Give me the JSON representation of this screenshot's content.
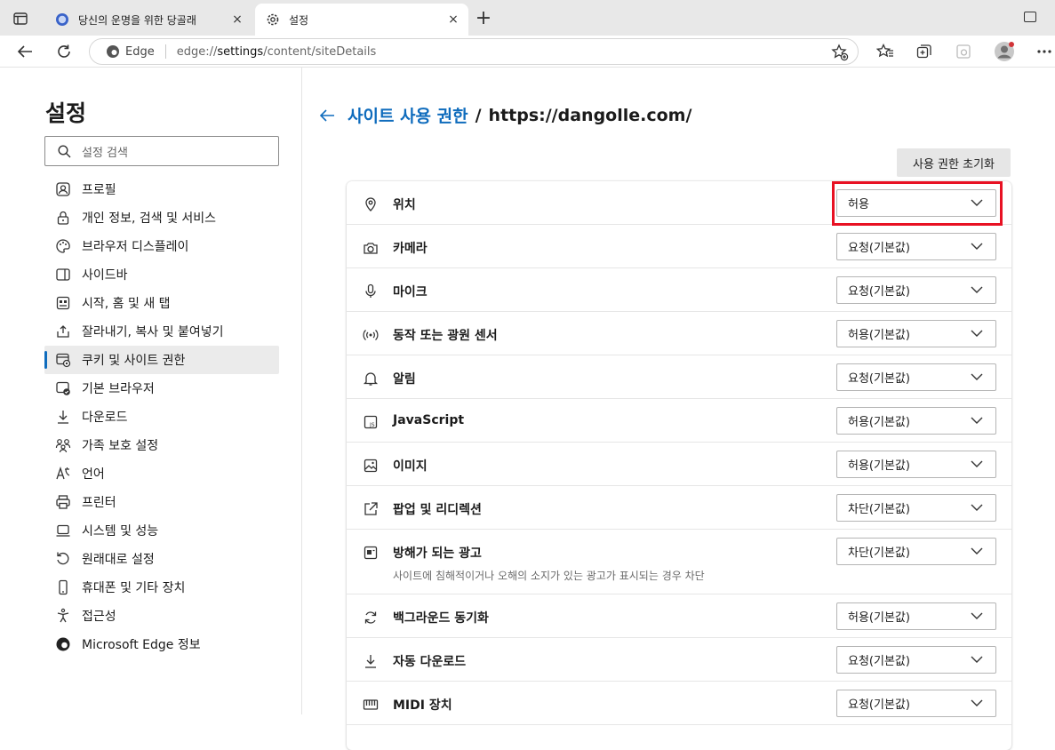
{
  "tabs": [
    {
      "title": "당신의 운명을 위한 당골래",
      "close": "×"
    },
    {
      "title": "설정",
      "close": "×"
    }
  ],
  "new_tab": "+",
  "address_bar": {
    "browser_label": "Edge",
    "url_scheme": "edge://",
    "url_host": "settings",
    "url_path": "/content/siteDetails"
  },
  "sidebar": {
    "title": "설정",
    "search_placeholder": "설정 검색",
    "items": [
      {
        "label": "프로필",
        "icon": "profile-icon"
      },
      {
        "label": "개인 정보, 검색 및 서비스",
        "icon": "lock-icon"
      },
      {
        "label": "브라우저 디스플레이",
        "icon": "palette-icon"
      },
      {
        "label": "사이드바",
        "icon": "sidebar-icon"
      },
      {
        "label": "시작, 홈 및 새 탭",
        "icon": "start-home-icon"
      },
      {
        "label": "잘라내기, 복사 및 붙여넣기",
        "icon": "share-icon"
      },
      {
        "label": "쿠키 및 사이트 권한",
        "icon": "site-permissions-icon",
        "active": true
      },
      {
        "label": "기본 브라우저",
        "icon": "default-browser-icon"
      },
      {
        "label": "다운로드",
        "icon": "download-icon"
      },
      {
        "label": "가족 보호 설정",
        "icon": "family-icon"
      },
      {
        "label": "언어",
        "icon": "language-icon"
      },
      {
        "label": "프린터",
        "icon": "printer-icon"
      },
      {
        "label": "시스템 및 성능",
        "icon": "system-icon"
      },
      {
        "label": "원래대로 설정",
        "icon": "reset-icon"
      },
      {
        "label": "휴대폰 및 기타 장치",
        "icon": "phone-icon"
      },
      {
        "label": "접근성",
        "icon": "accessibility-icon"
      },
      {
        "label": "Microsoft Edge 정보",
        "icon": "edge-logo-icon"
      }
    ]
  },
  "main": {
    "breadcrumb_link": "사이트 사용 권한",
    "breadcrumb_sep": "/",
    "breadcrumb_site": "https://dangolle.com/",
    "reset_button": "사용 권한 초기화",
    "permissions": [
      {
        "label": "위치",
        "value": "허용",
        "icon": "location-icon",
        "highlighted": true
      },
      {
        "label": "카메라",
        "value": "요청(기본값)",
        "icon": "camera-icon"
      },
      {
        "label": "마이크",
        "value": "요청(기본값)",
        "icon": "microphone-icon"
      },
      {
        "label": "동작 또는 광원 센서",
        "value": "허용(기본값)",
        "icon": "sensor-icon"
      },
      {
        "label": "알림",
        "value": "요청(기본값)",
        "icon": "bell-icon"
      },
      {
        "label": "JavaScript",
        "value": "허용(기본값)",
        "icon": "javascript-icon"
      },
      {
        "label": "이미지",
        "value": "허용(기본값)",
        "icon": "image-icon"
      },
      {
        "label": "팝업 및 리디렉션",
        "value": "차단(기본값)",
        "icon": "popup-icon"
      },
      {
        "label": "방해가 되는 광고",
        "value": "차단(기본값)",
        "icon": "ads-icon",
        "description": "사이트에 침해적이거나 오해의 소지가 있는 광고가 표시되는 경우 차단"
      },
      {
        "label": "백그라운드 동기화",
        "value": "허용(기본값)",
        "icon": "sync-icon"
      },
      {
        "label": "자동 다운로드",
        "value": "요청(기본값)",
        "icon": "download-icon"
      },
      {
        "label": "MIDI 장치",
        "value": "요청(기본값)",
        "icon": "midi-icon"
      }
    ]
  },
  "colors": {
    "accent": "#0f6cbd",
    "highlight": "#e81123"
  }
}
